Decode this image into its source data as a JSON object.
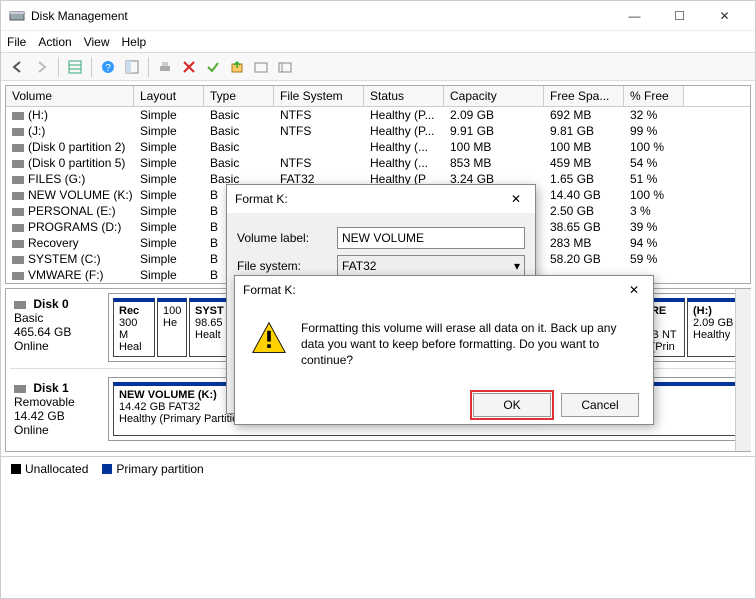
{
  "window": {
    "title": "Disk Management"
  },
  "menu": {
    "file": "File",
    "action": "Action",
    "view": "View",
    "help": "Help"
  },
  "table": {
    "headers": [
      "Volume",
      "Layout",
      "Type",
      "File System",
      "Status",
      "Capacity",
      "Free Spa...",
      "% Free"
    ],
    "rows": [
      {
        "vol": "(H:)",
        "layout": "Simple",
        "type": "Basic",
        "fs": "NTFS",
        "status": "Healthy (P...",
        "cap": "2.09 GB",
        "free": "692 MB",
        "pct": "32 %"
      },
      {
        "vol": "(J:)",
        "layout": "Simple",
        "type": "Basic",
        "fs": "NTFS",
        "status": "Healthy (P...",
        "cap": "9.91 GB",
        "free": "9.81 GB",
        "pct": "99 %"
      },
      {
        "vol": "(Disk 0 partition 2)",
        "layout": "Simple",
        "type": "Basic",
        "fs": "",
        "status": "Healthy (...",
        "cap": "100 MB",
        "free": "100 MB",
        "pct": "100 %"
      },
      {
        "vol": "(Disk 0 partition 5)",
        "layout": "Simple",
        "type": "Basic",
        "fs": "NTFS",
        "status": "Healthy (...",
        "cap": "853 MB",
        "free": "459 MB",
        "pct": "54 %"
      },
      {
        "vol": "FILES (G:)",
        "layout": "Simple",
        "type": "Basic",
        "fs": "FAT32",
        "status": "Healthy (P",
        "cap": "3.24 GB",
        "free": "1.65 GB",
        "pct": "51 %"
      },
      {
        "vol": "NEW VOLUME (K:)",
        "layout": "Simple",
        "type": "B",
        "fs": "",
        "status": "",
        "cap": "",
        "free": "14.40 GB",
        "pct": "100 %"
      },
      {
        "vol": "PERSONAL (E:)",
        "layout": "Simple",
        "type": "B",
        "fs": "",
        "status": "",
        "cap": "",
        "free": "2.50 GB",
        "pct": "3 %"
      },
      {
        "vol": "PROGRAMS (D:)",
        "layout": "Simple",
        "type": "B",
        "fs": "",
        "status": "",
        "cap": "",
        "free": "38.65 GB",
        "pct": "39 %"
      },
      {
        "vol": "Recovery",
        "layout": "Simple",
        "type": "B",
        "fs": "",
        "status": "",
        "cap": "",
        "free": "283 MB",
        "pct": "94 %"
      },
      {
        "vol": "SYSTEM (C:)",
        "layout": "Simple",
        "type": "B",
        "fs": "",
        "status": "",
        "cap": "",
        "free": "58.20 GB",
        "pct": "59 %"
      },
      {
        "vol": "VMWARE (F:)",
        "layout": "Simple",
        "type": "B",
        "fs": "",
        "status": "",
        "cap": "",
        "free": "",
        "pct": ""
      }
    ]
  },
  "disks": {
    "d0": {
      "name": "Disk 0",
      "type": "Basic",
      "size": "465.64 GB",
      "status": "Online",
      "parts": [
        {
          "name": "Rec",
          "l2": "300 M",
          "l3": "Heal"
        },
        {
          "name": "",
          "l2": "100",
          "l3": "He"
        },
        {
          "name": "SYST",
          "l2": "98.65",
          "l3": "Healt"
        },
        {
          "name": "ARE (F",
          "l2": "GB NT",
          "l3": "y (Prin"
        },
        {
          "name": "(H:)",
          "l2": "2.09 GB",
          "l3": "Healthy"
        }
      ]
    },
    "d1": {
      "name": "Disk 1",
      "type": "Removable",
      "size": "14.42 GB",
      "status": "Online",
      "parts": [
        {
          "name": "NEW VOLUME  (K:)",
          "l2": "14.42 GB FAT32",
          "l3": "Healthy (Primary Partition)"
        }
      ]
    }
  },
  "legend": {
    "unalloc": "Unallocated",
    "primary": "Primary partition"
  },
  "formatDlg": {
    "title": "Format K:",
    "labelVolume": "Volume label:",
    "volumeValue": "NEW VOLUME",
    "labelFs": "File system:",
    "fsValue": "FAT32"
  },
  "confirmDlg": {
    "title": "Format K:",
    "message": "Formatting this volume will erase all data on it. Back up any data you want to keep before formatting. Do you want to continue?",
    "ok": "OK",
    "cancel": "Cancel"
  }
}
